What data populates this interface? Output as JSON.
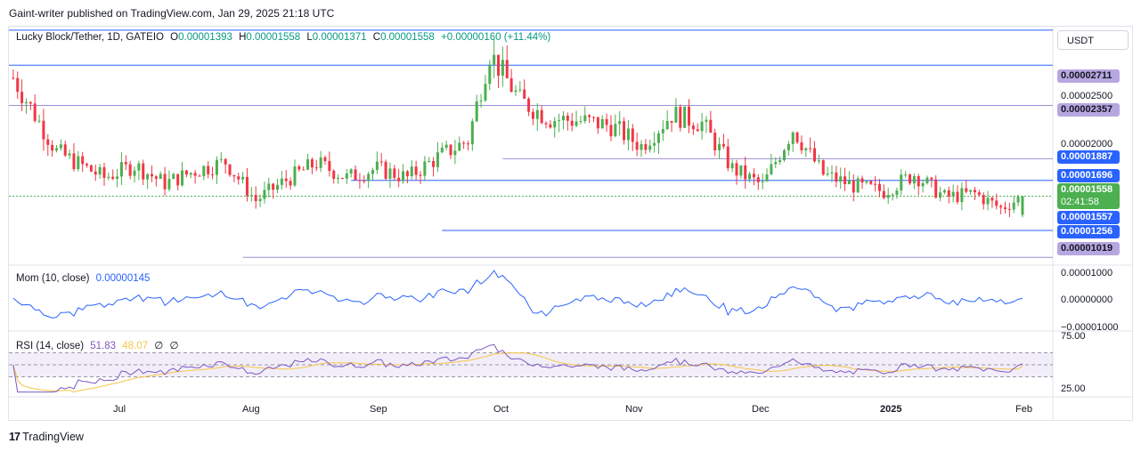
{
  "header": {
    "published": "Gaint-writer published on TradingView.com, Jan 29, 2025 21:18 UTC"
  },
  "legend": {
    "symbol": "Lucky Block/Tether, 1D, GATEIO",
    "o_label": "O",
    "o": "0.00001393",
    "h_label": "H",
    "h": "0.00001558",
    "l_label": "L",
    "l": "0.00001371",
    "c_label": "C",
    "c": "0.00001558",
    "change": "+0.00000160 (+11.44%)"
  },
  "currency": "USDT",
  "price_axis": {
    "labels": [
      "0.00002500",
      "0.00002000"
    ],
    "tags": [
      {
        "text": "0.00002711",
        "style": "purple"
      },
      {
        "text": "0.00002357",
        "style": "purple"
      },
      {
        "text": "0.00001887",
        "style": "blue"
      },
      {
        "text": "0.00001696",
        "style": "blue"
      },
      {
        "text": "0.00001558",
        "style": "green"
      },
      {
        "text": "02:41:58",
        "style": "green"
      },
      {
        "text": "0.00001557",
        "style": "blue"
      },
      {
        "text": "0.00001256",
        "style": "blue"
      },
      {
        "text": "0.00001019",
        "style": "purple"
      }
    ]
  },
  "mom": {
    "label": "Mom (10, close)",
    "value": "0.00000145",
    "axis": [
      "0.00001000",
      "0.00000000",
      "−0.00001000"
    ]
  },
  "rsi": {
    "label": "RSI (14, close)",
    "value": "51.83",
    "ma": "48.07",
    "extra1": "∅",
    "extra2": "∅",
    "axis": [
      "75.00",
      "25.00"
    ]
  },
  "x_axis": [
    "Jul",
    "Aug",
    "Sep",
    "Oct",
    "Nov",
    "Dec",
    "2025",
    "Feb"
  ],
  "footer": {
    "brand": "TradingView"
  },
  "colors": {
    "up": "#4caf50",
    "down": "#f23645",
    "level": "#2962ff",
    "level_purple": "#9b8fd4",
    "mom": "#2962ff",
    "rsi": "#7e57c2",
    "rsi_ma": "#f7c548"
  },
  "chart_data": [
    {
      "type": "candlestick",
      "title": "Lucky Block/Tether, 1D, GATEIO",
      "x_range": [
        "2024-06-09",
        "2025-01-29"
      ],
      "ylim": [
        9.5e-06,
        3.05e-05
      ],
      "horizontal_levels": [
        2.711e-05,
        2.357e-05,
        1.887e-05,
        1.696e-05,
        1.557e-05,
        1.256e-05,
        1.019e-05
      ],
      "last": {
        "date": "2025-01-29",
        "open": 1.393e-05,
        "high": 1.558e-05,
        "low": 1.371e-05,
        "close": 1.558e-05
      },
      "approx_closes": [
        [
          "2024-06-10",
          2.6e-05
        ],
        [
          "2024-06-20",
          1.95e-05
        ],
        [
          "2024-07-01",
          1.72e-05
        ],
        [
          "2024-07-08",
          1.83e-05
        ],
        [
          "2024-07-15",
          1.67e-05
        ],
        [
          "2024-07-22",
          1.78e-05
        ],
        [
          "2024-07-29",
          1.86e-05
        ],
        [
          "2024-08-05",
          1.52e-05
        ],
        [
          "2024-08-12",
          1.7e-05
        ],
        [
          "2024-08-19",
          1.85e-05
        ],
        [
          "2024-08-26",
          1.72e-05
        ],
        [
          "2024-09-02",
          1.8e-05
        ],
        [
          "2024-09-09",
          1.72e-05
        ],
        [
          "2024-09-16",
          1.9e-05
        ],
        [
          "2024-09-23",
          2.05e-05
        ],
        [
          "2024-09-28",
          2.82e-05
        ],
        [
          "2024-10-05",
          2.4e-05
        ],
        [
          "2024-10-12",
          2.24e-05
        ],
        [
          "2024-10-19",
          2.22e-05
        ],
        [
          "2024-10-26",
          2.18e-05
        ],
        [
          "2024-11-02",
          2e-05
        ],
        [
          "2024-11-09",
          2.28e-05
        ],
        [
          "2024-11-16",
          2.2e-05
        ],
        [
          "2024-11-23",
          1.8e-05
        ],
        [
          "2024-11-30",
          1.65e-05
        ],
        [
          "2024-12-07",
          2.15e-05
        ],
        [
          "2024-12-14",
          1.75e-05
        ],
        [
          "2024-12-21",
          1.65e-05
        ],
        [
          "2024-12-28",
          1.6e-05
        ],
        [
          "2025-01-04",
          1.75e-05
        ],
        [
          "2025-01-11",
          1.55e-05
        ],
        [
          "2025-01-18",
          1.58e-05
        ],
        [
          "2025-01-24",
          1.45e-05
        ],
        [
          "2025-01-29",
          1.558e-05
        ]
      ]
    },
    {
      "type": "line",
      "title": "Mom (10, close)",
      "ylim": [
        -1e-05,
        1e-05
      ],
      "series": [
        {
          "name": "Mom",
          "last": 1.45e-06
        }
      ]
    },
    {
      "type": "line",
      "title": "RSI (14, close)",
      "ylim": [
        0,
        100
      ],
      "bands": [
        70,
        30
      ],
      "series": [
        {
          "name": "RSI",
          "last": 51.83
        },
        {
          "name": "RSI-based MA",
          "last": 48.07
        }
      ]
    }
  ]
}
